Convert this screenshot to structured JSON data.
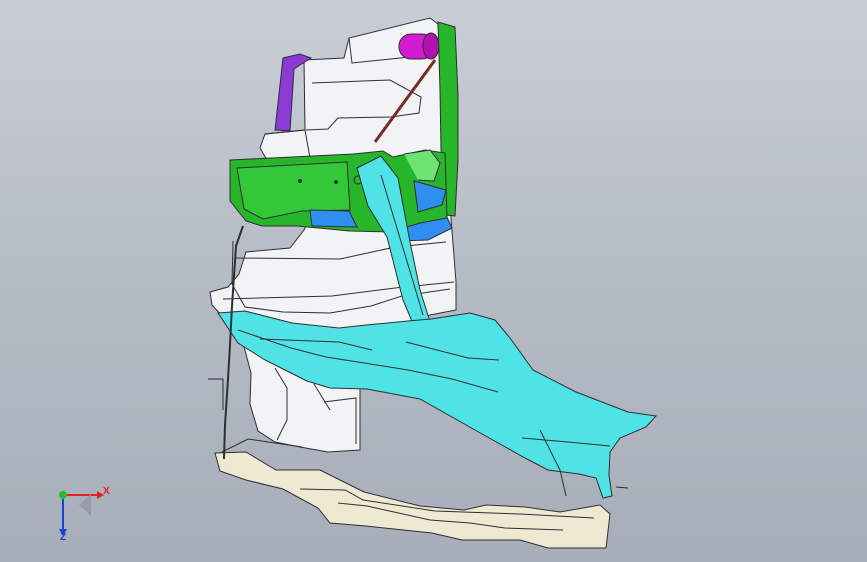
{
  "viewport": {
    "background_top": "#c9ced6",
    "background_bottom": "#a7aeb9"
  },
  "model": {
    "colors": {
      "white_parts": "#f2f3f5",
      "cyan_parts": "#4fe3e6",
      "green_parts": "#27b52a",
      "magenta_parts": "#d21bd2",
      "purple_parts": "#8c3ad6",
      "blue_parts": "#2f8ff0",
      "cream_parts": "#efe9d2",
      "outline": "#2c2f34"
    }
  },
  "triad": {
    "x_label": "X",
    "z_label": "Z",
    "x_color": "#e02222",
    "y_color": "#1fbf2f",
    "z_color": "#1e3fd6"
  }
}
